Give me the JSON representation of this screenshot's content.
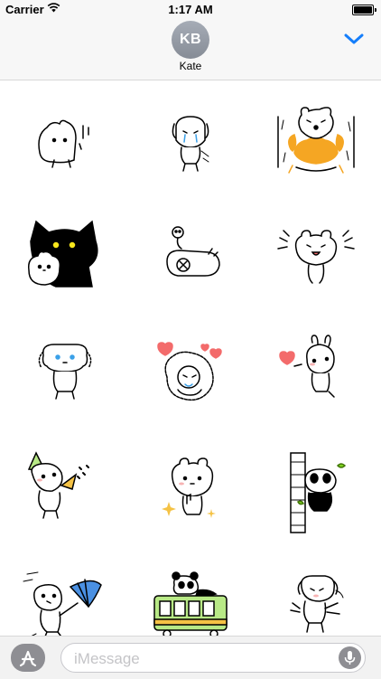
{
  "status_bar": {
    "carrier": "Carrier",
    "time": "1:17 AM",
    "wifi_icon": "wifi-icon",
    "battery_icon": "battery-icon"
  },
  "header": {
    "avatar_initials": "KB",
    "contact_name": "Kate",
    "collapse_icon": "chevron-down-icon",
    "accent_color": "#157efb"
  },
  "stickers": [
    {
      "name": "sticker-bear-peeking"
    },
    {
      "name": "sticker-dog-crying"
    },
    {
      "name": "sticker-bear-lion-mane"
    },
    {
      "name": "sticker-black-cat-with-bear"
    },
    {
      "name": "sticker-bear-fainted-skull"
    },
    {
      "name": "sticker-bear-shouting"
    },
    {
      "name": "sticker-dog-sweating"
    },
    {
      "name": "sticker-lion-hugging-hearts"
    },
    {
      "name": "sticker-rabbit-blowing-kiss"
    },
    {
      "name": "sticker-bear-party-popper"
    },
    {
      "name": "sticker-bear-thumbs-up"
    },
    {
      "name": "sticker-panda-hiding-wall"
    },
    {
      "name": "sticker-bear-umbrella-wind"
    },
    {
      "name": "sticker-panda-on-train"
    },
    {
      "name": "sticker-dog-stretching"
    }
  ],
  "bottom_bar": {
    "app_store_icon": "app-store-icon",
    "message_placeholder": "iMessage",
    "mic_icon": "microphone-icon"
  }
}
